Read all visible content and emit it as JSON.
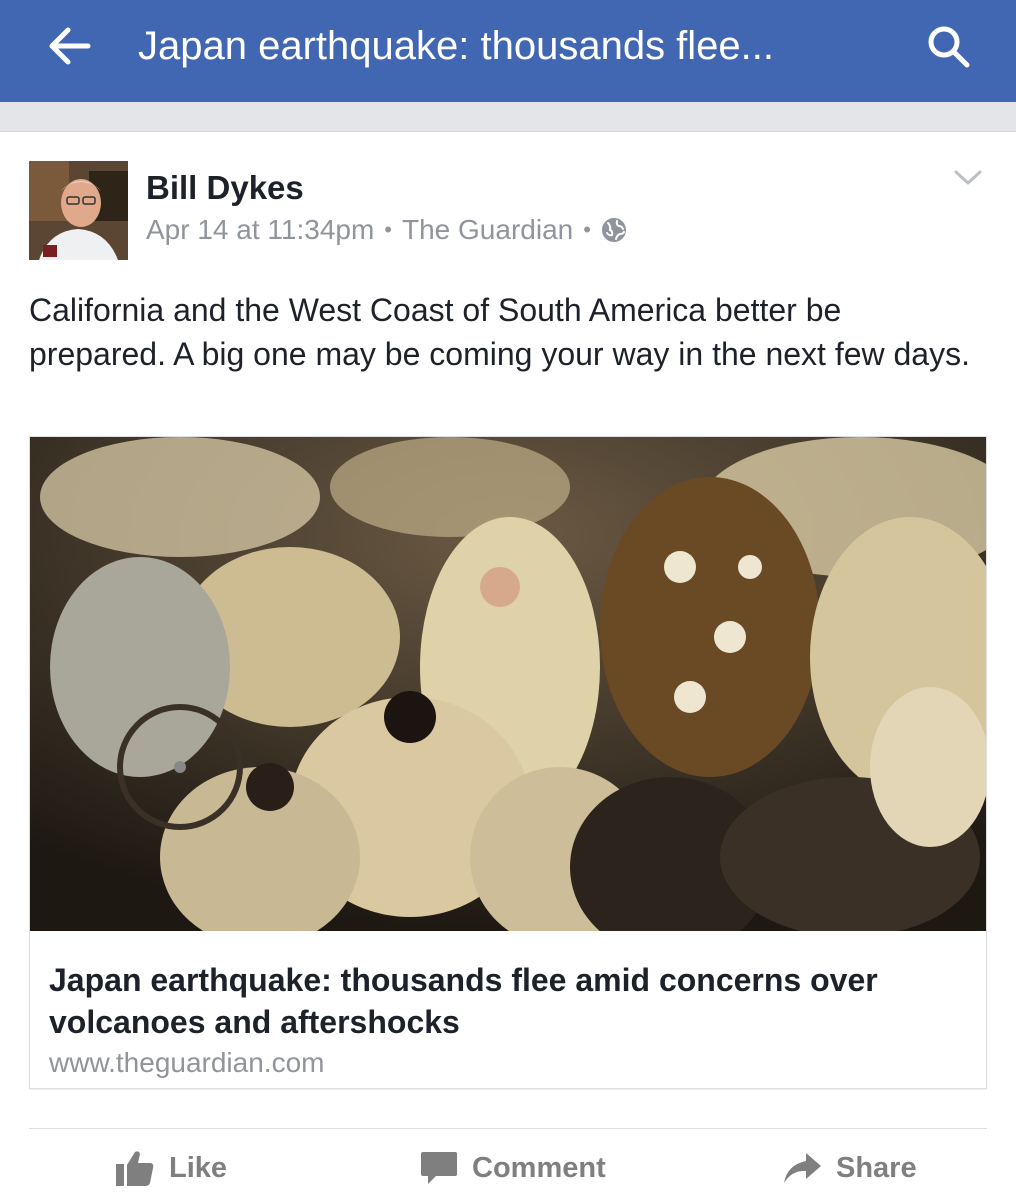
{
  "header": {
    "title": "Japan earthquake: thousands flee...",
    "back_icon": "arrow-left-icon",
    "search_icon": "search-icon",
    "background_color": "#4267b2"
  },
  "post": {
    "author": "Bill Dykes",
    "timestamp": "Apr 14 at 11:34pm",
    "via": "The Guardian",
    "separator": "•",
    "privacy_icon": "globe-icon",
    "options_icon": "chevron-down-icon",
    "text": "California and the West Coast of South America better be prepared. A big one may be coming your way in the next few days."
  },
  "link_card": {
    "title": "Japan earthquake: thousands flee amid concerns over volcanoes and aftershocks",
    "domain": "www.theguardian.com",
    "image_description_icon": "photo-evacuees-in-blankets"
  },
  "actions": {
    "like": "Like",
    "comment": "Comment",
    "share": "Share"
  }
}
